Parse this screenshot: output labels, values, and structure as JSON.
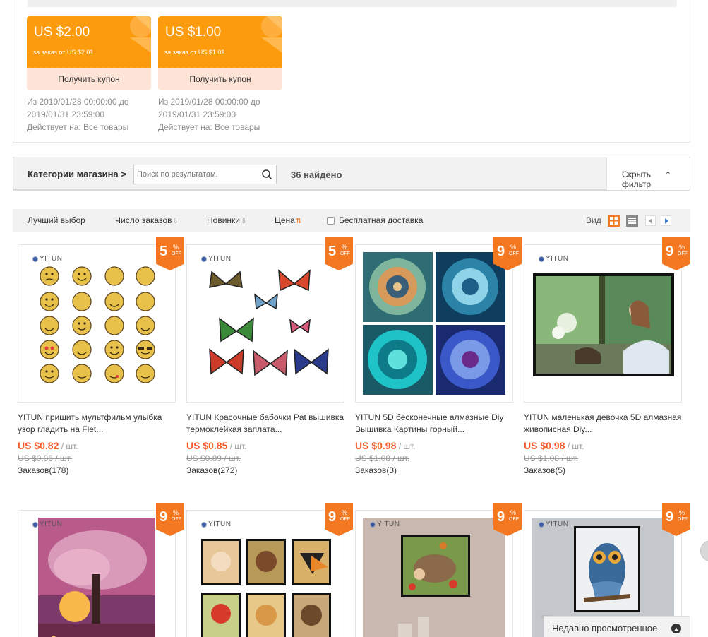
{
  "coupons": [
    {
      "amount": "US $2.00",
      "condition": "за заказ от US $2.01",
      "button": "Получить купон",
      "valid_from": "Из 2019/01/28 00:00:00 до",
      "valid_to": "2019/01/31 23:59:00",
      "applies": "Действует на: Все товары"
    },
    {
      "amount": "US $1.00",
      "condition": "за заказ от US $1.01",
      "button": "Получить купон",
      "valid_from": "Из 2019/01/28 00:00:00 до",
      "valid_to": "2019/01/31 23:59:00",
      "applies": "Действует на: Все товары"
    }
  ],
  "filter": {
    "categories_label": "Категории магазина >",
    "search_placeholder": "Поиск по результатам.",
    "found": "36 найдено",
    "hide_filter_line1": "Скрыть",
    "hide_filter_line2": "фильтр"
  },
  "sort": {
    "best": "Лучший выбор",
    "orders": "Число заказов",
    "newest": "Новинки",
    "price": "Цена",
    "free_shipping": "Бесплатная доставка",
    "view_label": "Вид"
  },
  "products": [
    {
      "brand": "YITUN",
      "discount": "5",
      "title": "YITUN пришить мультфильм улыбка узор гладить на Flet...",
      "price": "US $0.82",
      "unit": " / шт.",
      "old_price": "US $0.86 / шт.",
      "orders": "Заказов(178)"
    },
    {
      "brand": "YITUN",
      "discount": "5",
      "title": "YITUN Красочные бабочки Pat вышивка термоклейкая заплата...",
      "price": "US $0.85",
      "unit": " / шт.",
      "old_price": "US $0.89 / шт.",
      "orders": "Заказов(272)"
    },
    {
      "brand": "",
      "discount": "9",
      "title": "YITUN 5D бесконечные алмазные Diy Вышивка Картины горный...",
      "price": "US $0.98",
      "unit": " / шт.",
      "old_price": "US $1.08 / шт.",
      "orders": "Заказов(3)"
    },
    {
      "brand": "YITUN",
      "discount": "9",
      "title": "YITUN маленькая девочка 5D алмазная живописная Diy...",
      "price": "US $0.98",
      "unit": " / шт.",
      "old_price": "US $1.08 / шт.",
      "orders": "Заказов(5)"
    },
    {
      "brand": "YITUN",
      "discount": "9"
    },
    {
      "brand": "YITUN",
      "discount": "9"
    },
    {
      "brand": "YITUN",
      "discount": "9"
    },
    {
      "brand": "YITUN",
      "discount": "9"
    }
  ],
  "badge_pct": "%",
  "badge_off": "OFF",
  "recent": "Недавно просмотренное",
  "colors": {
    "accent": "#f37821",
    "coupon": "#fd9b0e",
    "price": "#f35b2b"
  }
}
